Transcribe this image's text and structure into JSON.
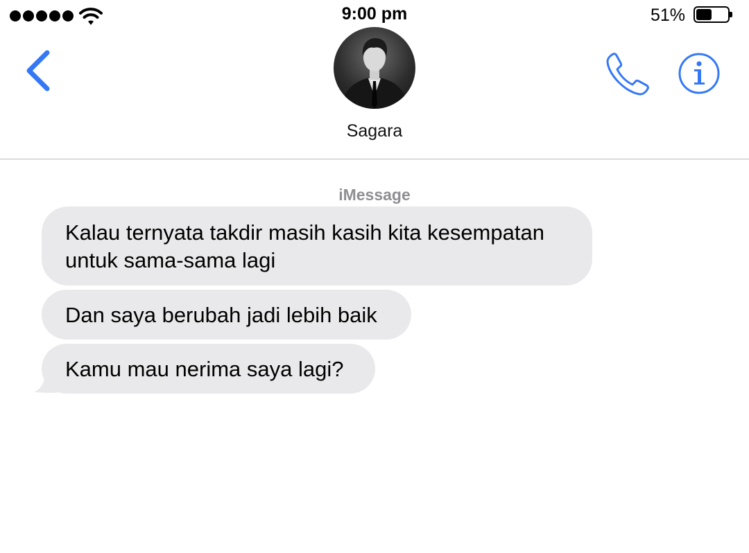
{
  "status_bar": {
    "signal_bars": 5,
    "wifi_icon": "wifi-icon",
    "time": "9:00 pm",
    "battery_percent": "51%",
    "battery_level": 0.51
  },
  "header": {
    "back_icon": "chevron-left-icon",
    "contact_name": "Sagara",
    "call_icon": "phone-icon",
    "info_icon": "info-icon",
    "accent_color": "#3478f6"
  },
  "thread": {
    "service_label": "iMessage",
    "incoming_bubble_color": "#e9e9eb",
    "messages": [
      {
        "sender": "contact",
        "text": "Kalau ternyata takdir masih kasih kita kesempatan\nuntuk sama-sama lagi"
      },
      {
        "sender": "contact",
        "text": "Dan saya berubah jadi lebih baik"
      },
      {
        "sender": "contact",
        "text": "Kamu mau nerima saya lagi?"
      }
    ]
  }
}
